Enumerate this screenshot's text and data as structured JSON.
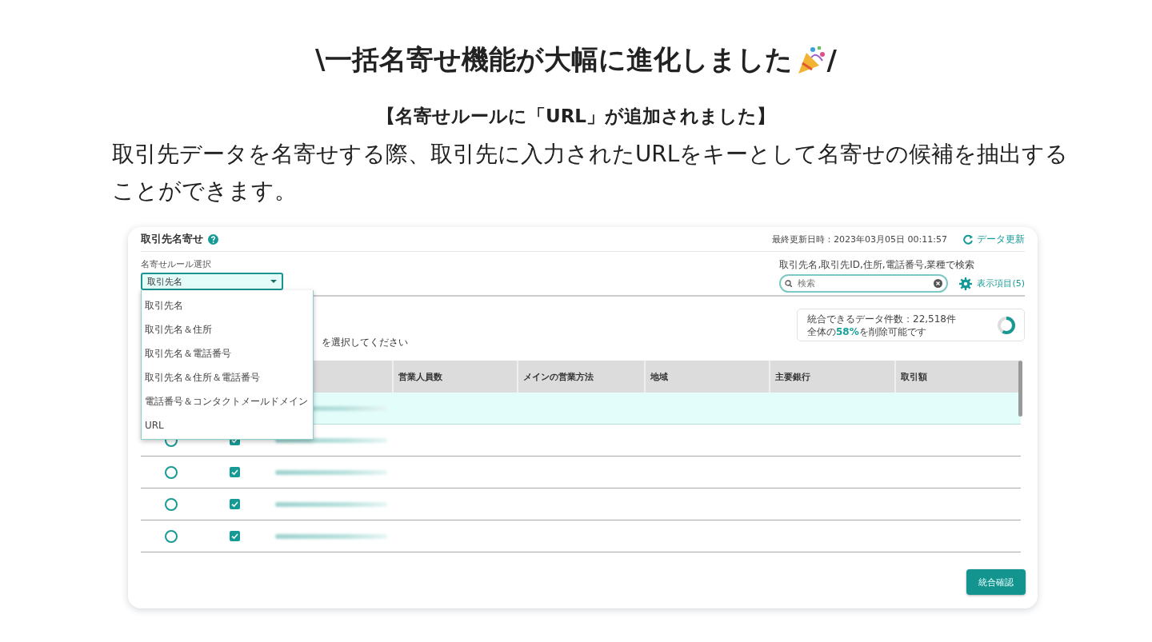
{
  "headline": {
    "before": "\\一括名寄せ機能が大幅に進化しました",
    "after": "/"
  },
  "subtitle": "【名寄せルールに「URL」が追加されました】",
  "description": "取引先データを名寄せする際、取引先に入力されたURLをキーとして名寄せの候補を抽出することができます。",
  "app": {
    "title": "取引先名寄せ",
    "last_updated": "最終更新日時：2023年03月05日 00:11:57",
    "refresh": "データ更新",
    "rule_label": "名寄せルール選択",
    "rule_value": "取引先名",
    "rule_options": [
      "取引先名",
      "取引先名＆住所",
      "取引先名＆電話番号",
      "取引先名＆住所＆電話番号",
      "電話番号＆コンタクトメールドメイン",
      "URL"
    ],
    "search_hint": "取引先名,取引先ID,住所,電話番号,業種で検索",
    "search": {
      "placeholder": "検索"
    },
    "columns_button": "表示項目(5)",
    "summary": {
      "count": "統合できるデータ件数：22,518件",
      "share": "全体の**58%**を削除可能です",
      "level": 0.58
    },
    "instruction": "を選択してください",
    "columns": [
      "営業人員数",
      "メインの営業方法",
      "地域",
      "主要銀行",
      "取引額"
    ],
    "rows": [
      {
        "selected": true
      },
      {
        "selected": false,
        "checked": true
      },
      {
        "selected": false,
        "checked": true
      },
      {
        "selected": false,
        "checked": true
      },
      {
        "selected": false,
        "checked": true
      }
    ],
    "confirm_button": "統合確認"
  }
}
